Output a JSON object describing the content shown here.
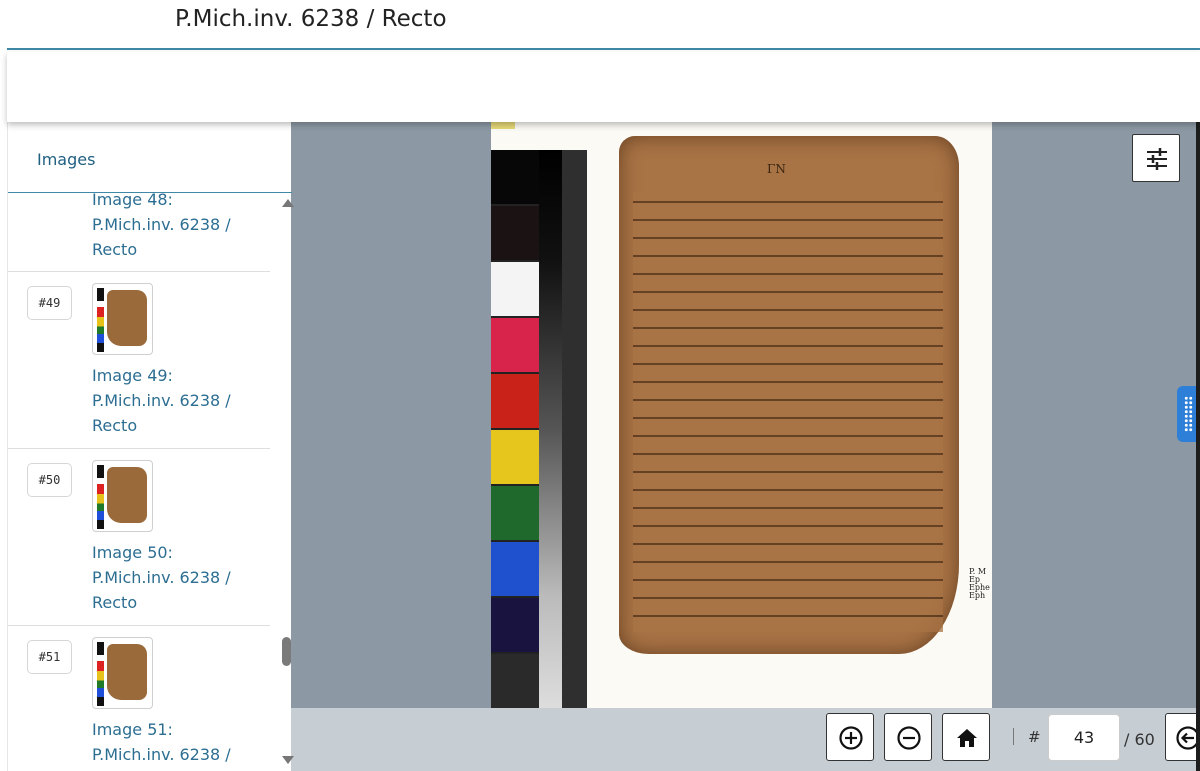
{
  "page_title": "P.Mich.inv. 6238 / Recto",
  "sidebar": {
    "tab_label": "Images",
    "items": [
      {
        "label": "Image 48: P.Mich.inv. 6238 / Recto"
      },
      {
        "index": "#49",
        "label": "Image 49: P.Mich.inv. 6238 / Recto"
      },
      {
        "index": "#50",
        "label": "Image 50: P.Mich.inv. 6238 / Recto"
      },
      {
        "index": "#51",
        "label": "Image 51: P.Mich.inv. 6238 /"
      }
    ]
  },
  "viewer": {
    "image_caption": "P. M\nEp\nEphe\nEph",
    "papyrus_heading": "ΓΝ"
  },
  "navigation": {
    "zoom_in_icon": "plus-circle-icon",
    "zoom_out_icon": "minus-circle-icon",
    "home_icon": "home-icon",
    "hash_label": "#",
    "current_page": "43",
    "total_pages": "/ 60",
    "previous_icon": "arrow-left-circle-icon"
  },
  "colors": {
    "accent": "#3f89a6",
    "link": "#2c6e92",
    "viewer_bg": "#8c98a4",
    "handle": "#2e7fd8"
  }
}
